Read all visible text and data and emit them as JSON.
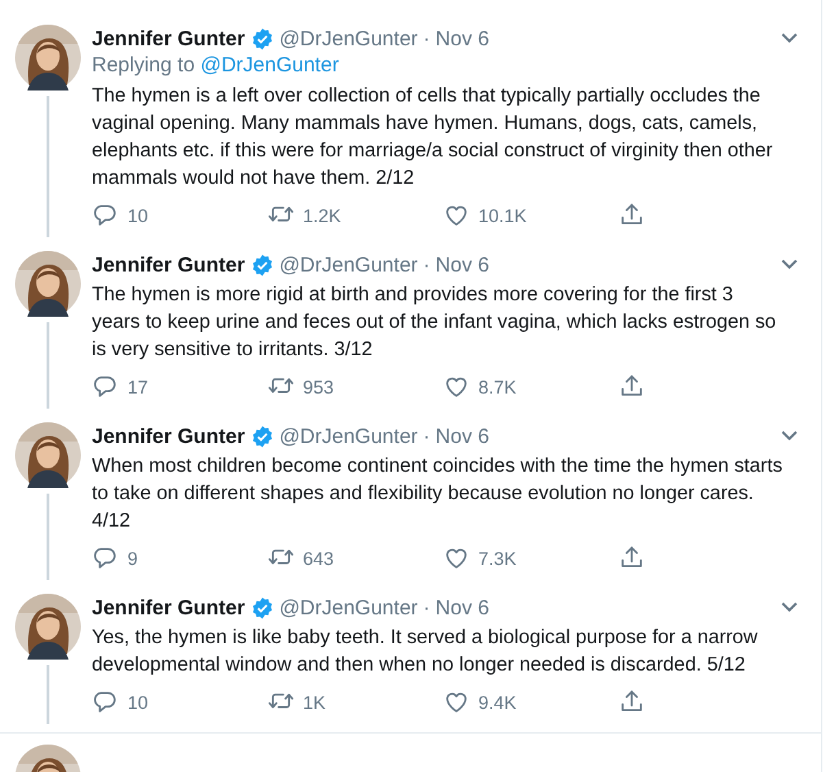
{
  "tweets": [
    {
      "author": "Jennifer Gunter",
      "verified": true,
      "handle": "@DrJenGunter",
      "separator": "·",
      "time": "Nov 6",
      "reply_label": "Replying to",
      "reply_to": "@DrJenGunter",
      "text": "The hymen is a left over collection of cells that typically partially occludes the vaginal opening. Many mammals have hymen. Humans, dogs, cats, camels, elephants etc. if this were for marriage/a social construct of virginity then other mammals would not have them. 2/12",
      "replies": "10",
      "retweets": "1.2K",
      "likes": "10.1K"
    },
    {
      "author": "Jennifer Gunter",
      "verified": true,
      "handle": "@DrJenGunter",
      "separator": "·",
      "time": "Nov 6",
      "text": "The hymen is more rigid at birth and provides more covering for the first 3 years to keep urine and feces out of the infant vagina, which lacks estrogen so is very sensitive to irritants. 3/12",
      "replies": "17",
      "retweets": "953",
      "likes": "8.7K"
    },
    {
      "author": "Jennifer Gunter",
      "verified": true,
      "handle": "@DrJenGunter",
      "separator": "·",
      "time": "Nov 6",
      "text": "When most children become continent coincides with the time the hymen starts to take on different shapes and flexibility because evolution no longer cares. 4/12",
      "replies": "9",
      "retweets": "643",
      "likes": "7.3K"
    },
    {
      "author": "Jennifer Gunter",
      "verified": true,
      "handle": "@DrJenGunter",
      "separator": "·",
      "time": "Nov 6",
      "text": "Yes, the hymen is like baby teeth. It served a biological purpose for a narrow developmental window and then when no longer needed is discarded. 5/12",
      "replies": "10",
      "retweets": "1K",
      "likes": "9.4K"
    }
  ]
}
